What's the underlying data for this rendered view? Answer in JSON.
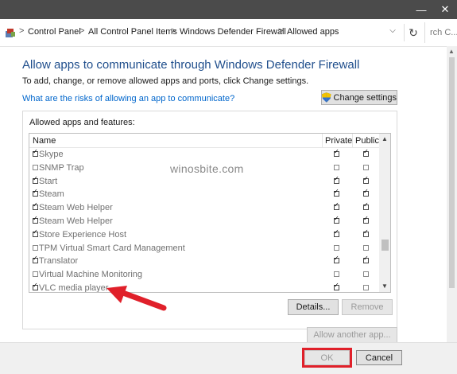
{
  "window": {
    "minimize_glyph": "—",
    "close_glyph": "✕"
  },
  "breadcrumb": {
    "items": [
      "Control Panel",
      "All Control Panel Items",
      "Windows Defender Firewall",
      "Allowed apps"
    ],
    "separator": ">",
    "search_placeholder": "rch C..."
  },
  "heading": "Allow apps to communicate through Windows Defender Firewall",
  "subtext": "To add, change, or remove allowed apps and ports, click Change settings.",
  "risk_link": "What are the risks of allowing an app to communicate?",
  "change_settings_label": "Change settings",
  "group_title": "Allowed apps and features:",
  "columns": {
    "name": "Name",
    "private": "Private",
    "public": "Public"
  },
  "apps": [
    {
      "name": "Skype",
      "enabled": true,
      "private": true,
      "public": true
    },
    {
      "name": "SNMP Trap",
      "enabled": false,
      "private": false,
      "public": false
    },
    {
      "name": "Start",
      "enabled": true,
      "private": true,
      "public": true
    },
    {
      "name": "Steam",
      "enabled": true,
      "private": true,
      "public": true
    },
    {
      "name": "Steam Web Helper",
      "enabled": true,
      "private": true,
      "public": true
    },
    {
      "name": "Steam Web Helper",
      "enabled": true,
      "private": true,
      "public": true
    },
    {
      "name": "Store Experience Host",
      "enabled": true,
      "private": true,
      "public": true
    },
    {
      "name": "TPM Virtual Smart Card Management",
      "enabled": false,
      "private": false,
      "public": false
    },
    {
      "name": "Translator",
      "enabled": true,
      "private": true,
      "public": true
    },
    {
      "name": "Virtual Machine Monitoring",
      "enabled": false,
      "private": false,
      "public": false
    },
    {
      "name": "VLC media player",
      "enabled": true,
      "private": true,
      "public": false
    }
  ],
  "details_label": "Details...",
  "remove_label": "Remove",
  "allow_another_label": "Allow another app...",
  "ok_label": "OK",
  "cancel_label": "Cancel",
  "watermark": "winosbite.com",
  "colors": {
    "heading": "#1f4e8c",
    "link": "#0066cc",
    "highlight": "#e0202a",
    "titlebar": "#4b4b4b"
  }
}
